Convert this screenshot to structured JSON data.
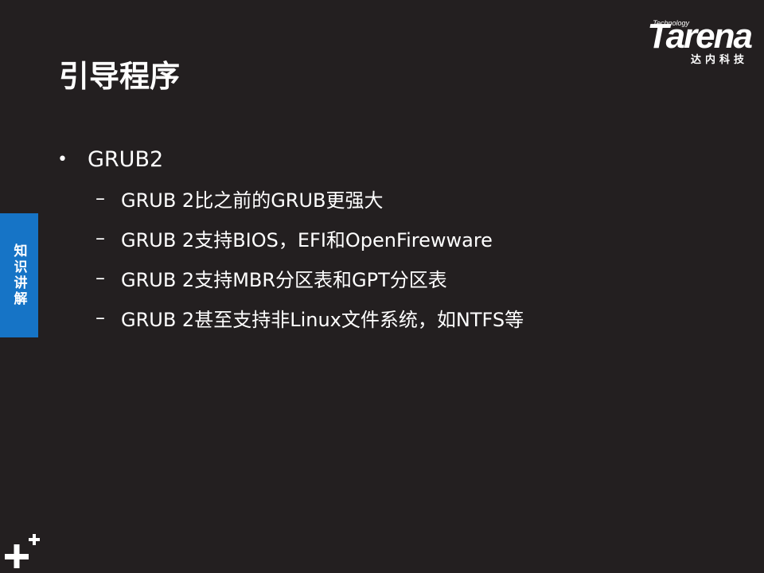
{
  "logo": {
    "word": "Tarena",
    "tag": "Technology",
    "cn": "达内科技"
  },
  "slide": {
    "title": "引导程序",
    "side_tab": "知识讲解"
  },
  "content": {
    "bullet": "GRUB2",
    "sub_items": [
      "GRUB 2比之前的GRUB更强大",
      "GRUB 2支持BIOS，EFI和OpenFirewware",
      "GRUB 2支持MBR分区表和GPT分区表",
      "GRUB 2甚至支持非Linux文件系统，如NTFS等"
    ]
  },
  "colors": {
    "background": "#231f20",
    "side_tab": "#1674c6",
    "text": "#ffffff"
  },
  "icons": {
    "corner": "plus-icon"
  }
}
